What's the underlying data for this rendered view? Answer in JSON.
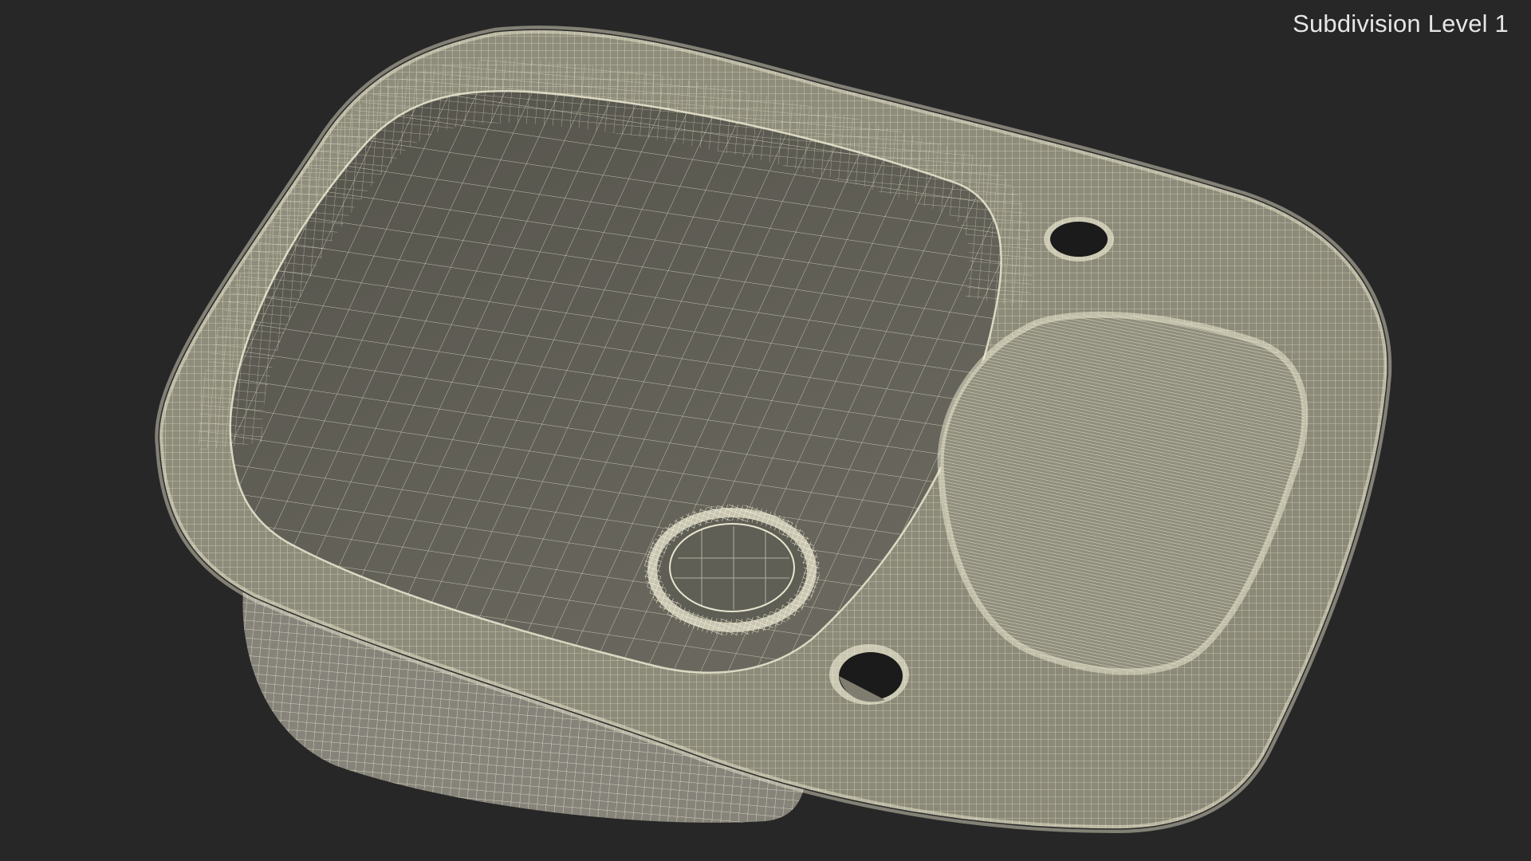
{
  "viewport": {
    "label": "Subdivision Level 1",
    "background_color": "#272727"
  },
  "model": {
    "subject": "kitchen sink with drainboard",
    "render_mode": "wireframe-on-shaded",
    "surface_color": "#8e8c7b",
    "basin_color": "#5f5e55",
    "wire_color": "#f3f0d8",
    "hole_color": "#1b1b1b"
  }
}
